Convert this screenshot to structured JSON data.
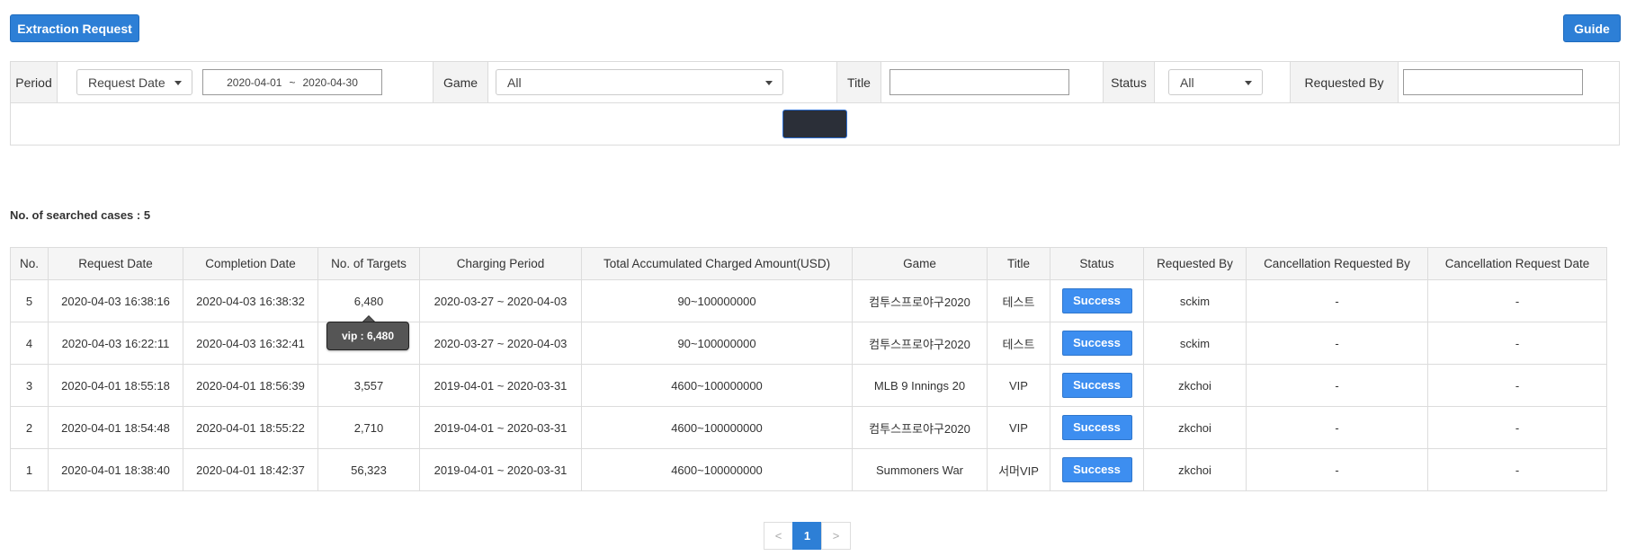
{
  "toolbar": {
    "extract_label": "Extraction Request",
    "guide_label": "Guide"
  },
  "filters": {
    "period_label": "Period",
    "period_type": "Request Date",
    "date_from": "2020-04-01",
    "date_sep": "~",
    "date_to": "2020-04-30",
    "game_label": "Game",
    "game_value": "All",
    "title_label": "Title",
    "title_value": "",
    "status_label": "Status",
    "status_value": "All",
    "requested_by_label": "Requested By",
    "requested_by_value": ""
  },
  "summary": {
    "count_text": "No. of searched cases : 5"
  },
  "table": {
    "headers": [
      "No.",
      "Request Date",
      "Completion Date",
      "No. of Targets",
      "Charging Period",
      "Total Accumulated Charged Amount(USD)",
      "Game",
      "Title",
      "Status",
      "Requested By",
      "Cancellation Requested By",
      "Cancellation Request Date"
    ],
    "rows": [
      {
        "no": "5",
        "request_date": "2020-04-03 16:38:16",
        "completion_date": "2020-04-03 16:38:32",
        "targets": "6,480",
        "charging_period": "2020-03-27 ~ 2020-04-03",
        "amount": "90~100000000",
        "game": "컴투스프로야구2020",
        "title": "테스트",
        "status": "Success",
        "requested_by": "sckim",
        "cancel_by": "-",
        "cancel_date": "-"
      },
      {
        "no": "4",
        "request_date": "2020-04-03 16:22:11",
        "completion_date": "2020-04-03 16:32:41",
        "targets": "",
        "charging_period": "2020-03-27 ~ 2020-04-03",
        "amount": "90~100000000",
        "game": "컴투스프로야구2020",
        "title": "테스트",
        "status": "Success",
        "requested_by": "sckim",
        "cancel_by": "-",
        "cancel_date": "-"
      },
      {
        "no": "3",
        "request_date": "2020-04-01 18:55:18",
        "completion_date": "2020-04-01 18:56:39",
        "targets": "3,557",
        "charging_period": "2019-04-01 ~ 2020-03-31",
        "amount": "4600~100000000",
        "game": "MLB 9 Innings 20",
        "title": "VIP",
        "status": "Success",
        "requested_by": "zkchoi",
        "cancel_by": "-",
        "cancel_date": "-"
      },
      {
        "no": "2",
        "request_date": "2020-04-01 18:54:48",
        "completion_date": "2020-04-01 18:55:22",
        "targets": "2,710",
        "charging_period": "2019-04-01 ~ 2020-03-31",
        "amount": "4600~100000000",
        "game": "컴투스프로야구2020",
        "title": "VIP",
        "status": "Success",
        "requested_by": "zkchoi",
        "cancel_by": "-",
        "cancel_date": "-"
      },
      {
        "no": "1",
        "request_date": "2020-04-01 18:38:40",
        "completion_date": "2020-04-01 18:42:37",
        "targets": "56,323",
        "charging_period": "2019-04-01 ~ 2020-03-31",
        "amount": "4600~100000000",
        "game": "Summoners War",
        "title": "서머VIP",
        "status": "Success",
        "requested_by": "zkchoi",
        "cancel_by": "-",
        "cancel_date": "-"
      }
    ]
  },
  "tooltip": {
    "text": "vip : 6,480"
  },
  "pagination": {
    "prev": "<",
    "current": "1",
    "next": ">"
  },
  "colors": {
    "primary": "#2d7fd6",
    "status_success": "#3d8ef0",
    "search_button": "#2b2f38"
  }
}
